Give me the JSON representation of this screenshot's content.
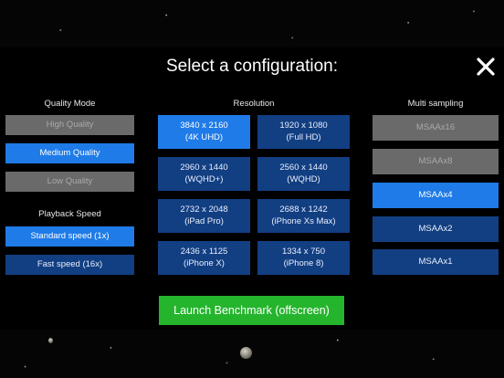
{
  "dialog": {
    "title": "Select a configuration:",
    "close_icon": "close-icon"
  },
  "quality": {
    "label": "Quality Mode",
    "options": [
      {
        "label": "High Quality",
        "state": "disabled"
      },
      {
        "label": "Medium Quality",
        "state": "selected"
      },
      {
        "label": "Low Quality",
        "state": "disabled"
      }
    ]
  },
  "playback": {
    "label": "Playback Speed",
    "options": [
      {
        "label": "Standard speed (1x)",
        "state": "selected"
      },
      {
        "label": "Fast speed (16x)",
        "state": "normal"
      }
    ]
  },
  "resolution": {
    "label": "Resolution",
    "options": [
      {
        "size": "3840 x 2160",
        "name": "(4K UHD)",
        "state": "selected"
      },
      {
        "size": "1920 x 1080",
        "name": "(Full HD)",
        "state": "normal"
      },
      {
        "size": "2960 x 1440",
        "name": "(WQHD+)",
        "state": "normal"
      },
      {
        "size": "2560 x 1440",
        "name": "(WQHD)",
        "state": "normal"
      },
      {
        "size": "2732 x 2048",
        "name": "(iPad Pro)",
        "state": "normal"
      },
      {
        "size": "2688 x 1242",
        "name": "(iPhone Xs Max)",
        "state": "normal"
      },
      {
        "size": "2436 x 1125",
        "name": "(iPhone X)",
        "state": "normal"
      },
      {
        "size": "1334 x 750",
        "name": "(iPhone 8)",
        "state": "normal"
      }
    ]
  },
  "multisampling": {
    "label": "Multi sampling",
    "options": [
      {
        "label": "MSAAx16",
        "state": "disabled"
      },
      {
        "label": "MSAAx8",
        "state": "disabled"
      },
      {
        "label": "MSAAx4",
        "state": "selected"
      },
      {
        "label": "MSAAx2",
        "state": "normal"
      },
      {
        "label": "MSAAx1",
        "state": "normal"
      }
    ]
  },
  "launch": {
    "label": "Launch Benchmark (offscreen)"
  },
  "colors": {
    "selected": "#1f7be8",
    "normal": "#123f82",
    "disabled": "#6a6a6a",
    "launch": "#24b52d"
  }
}
